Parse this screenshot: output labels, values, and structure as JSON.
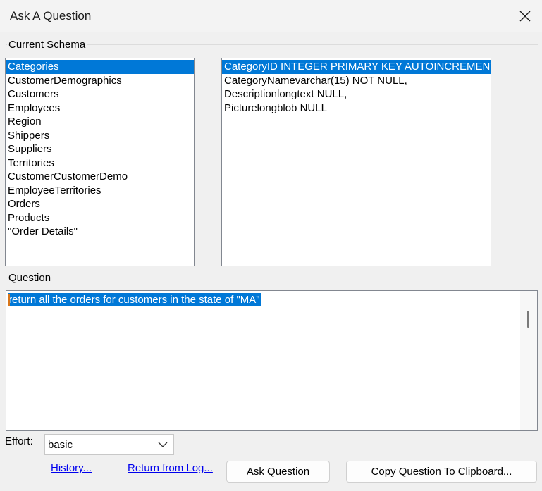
{
  "window": {
    "title": "Ask A Question",
    "close_icon": "close-icon"
  },
  "schema": {
    "group_label": "Current Schema",
    "tables": [
      "Categories",
      "CustomerDemographics",
      "Customers",
      "Employees",
      "Region",
      "Shippers",
      "Suppliers",
      "Territories",
      "CustomerCustomerDemo",
      "EmployeeTerritories",
      "Orders",
      "Products",
      "\"Order Details\""
    ],
    "selected_table": "Categories",
    "columns": [
      "CategoryID INTEGER PRIMARY KEY AUTOINCREMENT",
      "CategoryNamevarchar(15) NOT NULL,",
      "Descriptionlongtext NULL,",
      "Picturelongblob NULL"
    ],
    "selected_column_index": 0
  },
  "question": {
    "group_label": "Question",
    "text": "return all the orders for customers in the state of \"MA\""
  },
  "effort": {
    "label": "Effort:",
    "value": "basic"
  },
  "footer": {
    "history_link": "History...",
    "return_link": "Return from Log...",
    "ask_button_first": "A",
    "ask_button_rest": "sk Question",
    "copy_button_first": "C",
    "copy_button_rest": "opy Question To Clipboard..."
  }
}
